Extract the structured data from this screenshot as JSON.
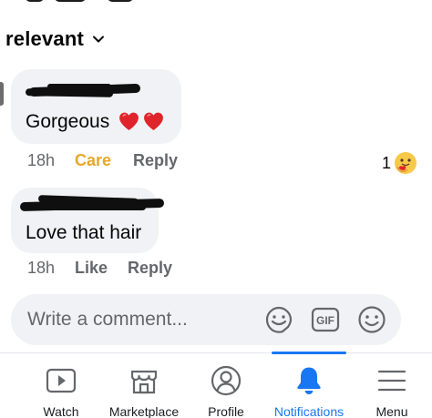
{
  "sort": {
    "label": "relevant"
  },
  "comments": [
    {
      "text": "Gorgeous",
      "time": "18h",
      "action_reaction": "Care",
      "action_reply": "Reply",
      "reaction_count": "1"
    },
    {
      "text": "Love that hair",
      "time": "18h",
      "action_like": "Like",
      "action_reply": "Reply"
    }
  ],
  "composer": {
    "placeholder": "Write a comment...",
    "gif_label": "GIF"
  },
  "nav": {
    "items": [
      {
        "label": "Watch",
        "icon": "watch-icon"
      },
      {
        "label": "Marketplace",
        "icon": "marketplace-icon"
      },
      {
        "label": "Profile",
        "icon": "profile-icon"
      },
      {
        "label": "Notifications",
        "icon": "bell-icon",
        "active": true
      },
      {
        "label": "Menu",
        "icon": "menu-icon"
      }
    ]
  },
  "colors": {
    "accent": "#1877f2",
    "care": "#e8a72a",
    "bubble": "#f0f2f5",
    "secondary_text": "#65676b"
  }
}
